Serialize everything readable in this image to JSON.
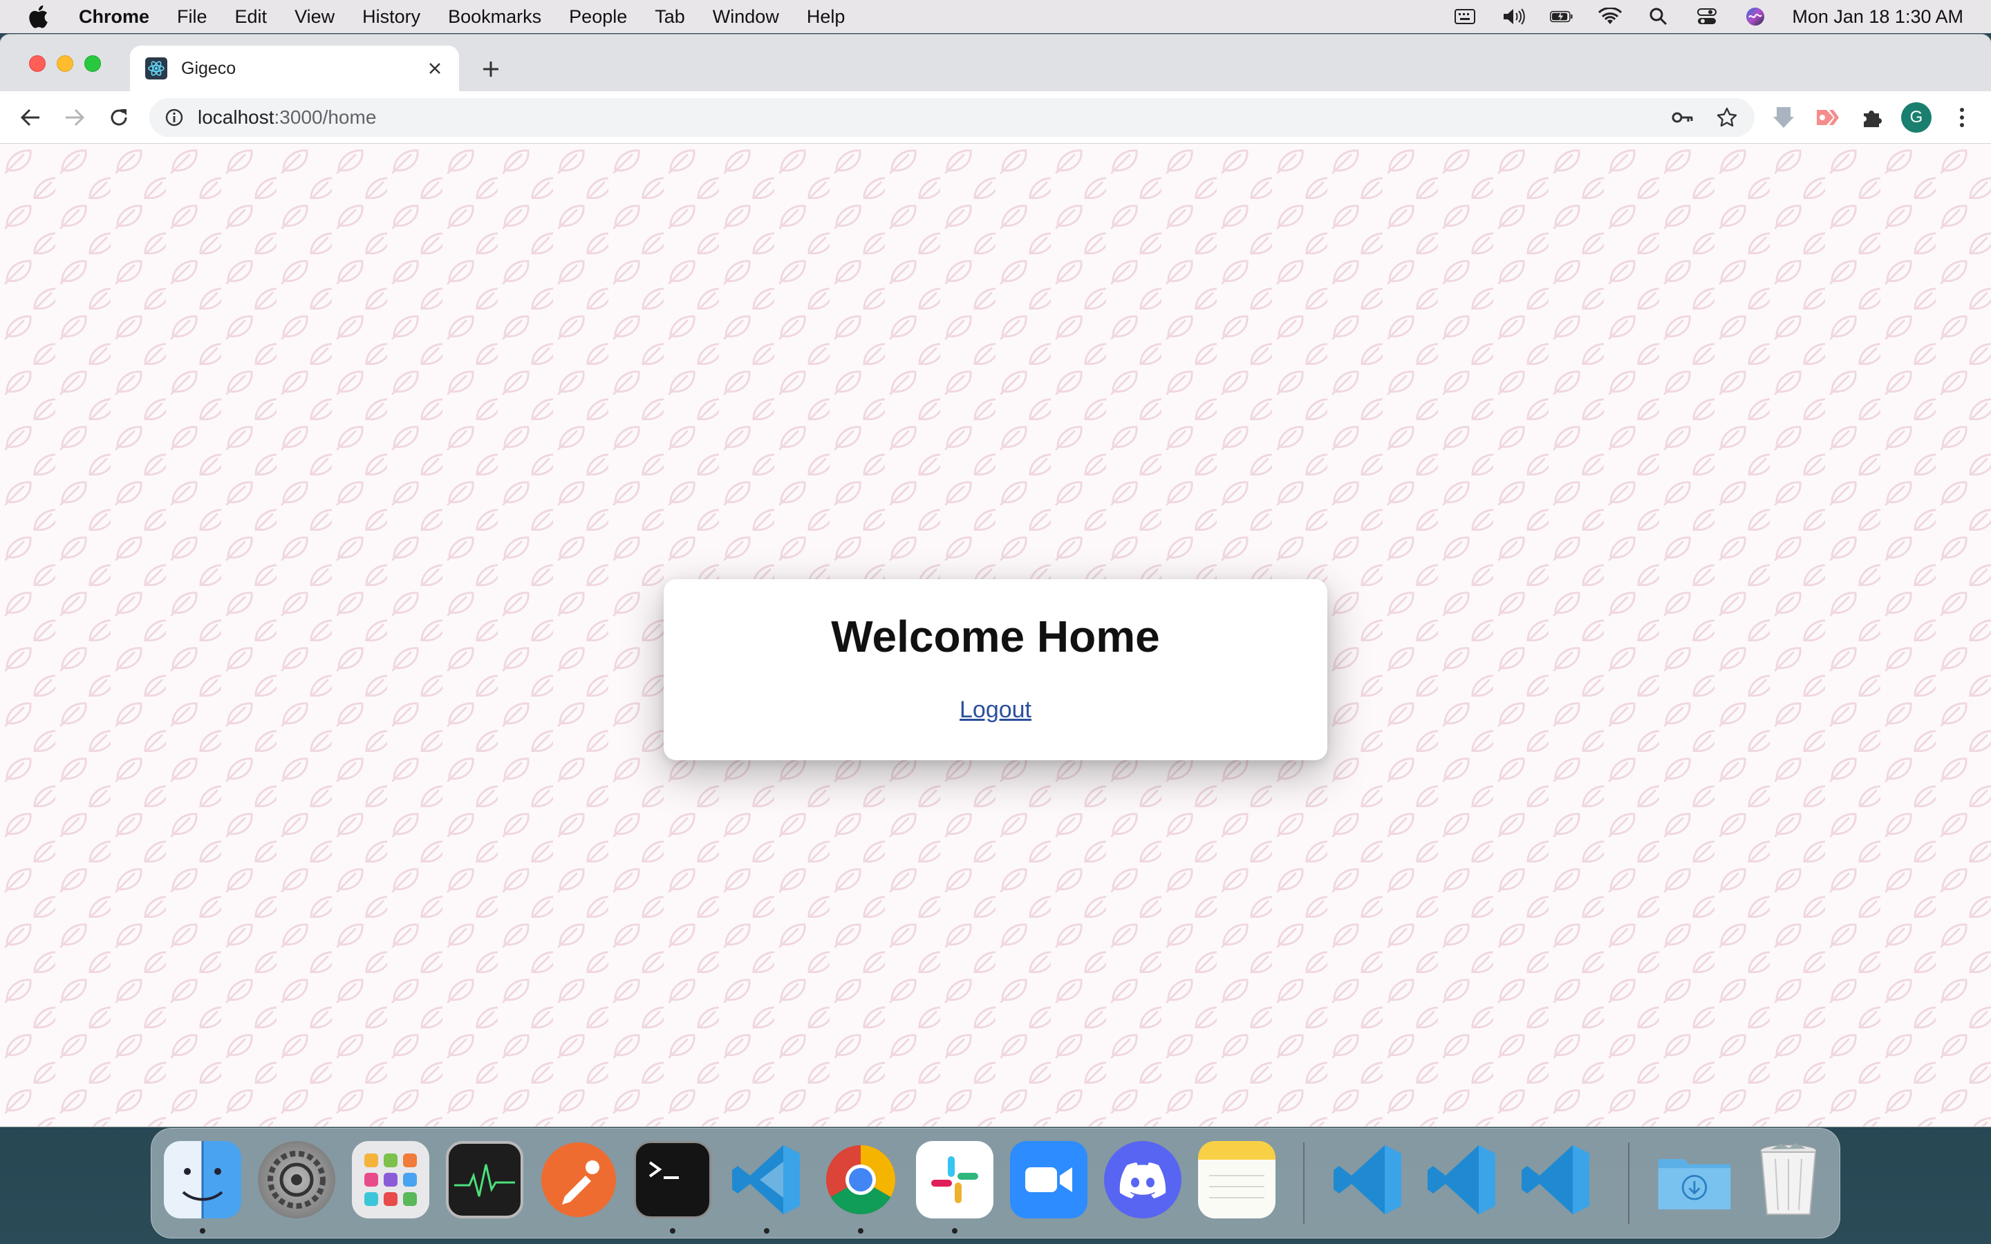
{
  "menubar": {
    "app_name": "Chrome",
    "items": [
      "File",
      "Edit",
      "View",
      "History",
      "Bookmarks",
      "People",
      "Tab",
      "Window",
      "Help"
    ],
    "clock": "Mon Jan 18  1:30 AM"
  },
  "browser": {
    "tab_title": "Gigeco",
    "url_host": "localhost",
    "url_path": ":3000/home",
    "profile_initial": "G"
  },
  "page": {
    "heading": "Welcome Home",
    "logout_label": "Logout"
  },
  "colors": {
    "pattern_leaf": "#f0d7e0",
    "link": "#2a4f9c",
    "profile": "#1a7f6e"
  },
  "dock": {
    "apps": [
      "Finder",
      "System Preferences",
      "Launchpad",
      "Activity Monitor",
      "Postman",
      "Terminal",
      "Visual Studio Code",
      "Google Chrome",
      "Slack",
      "Zoom",
      "Discord",
      "Notes",
      "Visual Studio Code",
      "Visual Studio Code",
      "Visual Studio Code",
      "Downloads",
      "Trash"
    ]
  }
}
